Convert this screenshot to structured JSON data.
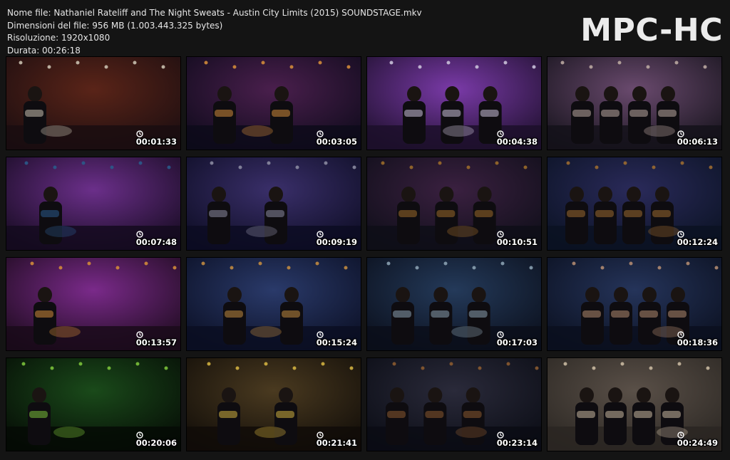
{
  "file_info": {
    "name_line": "Nome file: Nathaniel Rateliff and The Night Sweats - Austin City Limits (2015) SOUNDSTAGE.mkv",
    "size_line": "Dimensioni del file: 956 MB (1.003.443.325 bytes)",
    "resolution_line": "Risoluzione: 1920x1080",
    "duration_line": "Durata: 00:26:18"
  },
  "logo": "MPC-HC",
  "thumbnails": [
    {
      "time": "00:01:33",
      "scene": "drummer",
      "palette": [
        "#1a0d10",
        "#5a2418",
        "#c8bfae"
      ]
    },
    {
      "time": "00:03:05",
      "scene": "guitar-band",
      "palette": [
        "#0d0a1a",
        "#4a1f4d",
        "#d08a3a"
      ]
    },
    {
      "time": "00:04:38",
      "scene": "organ-purple",
      "palette": [
        "#1c0f2a",
        "#7a3aa8",
        "#c9c0d8"
      ]
    },
    {
      "time": "00:06:13",
      "scene": "drums-cymbals",
      "palette": [
        "#14121a",
        "#6a4a6e",
        "#b9a7a0"
      ]
    },
    {
      "time": "00:07:48",
      "scene": "wide-stage",
      "palette": [
        "#140a1e",
        "#6b2f8a",
        "#2a5a8a"
      ]
    },
    {
      "time": "00:09:19",
      "scene": "horns",
      "palette": [
        "#0c0c22",
        "#3a2f6a",
        "#8a8aa0"
      ]
    },
    {
      "time": "00:10:51",
      "scene": "keys-stage",
      "palette": [
        "#0e0e18",
        "#3a2040",
        "#9a6a2a"
      ]
    },
    {
      "time": "00:12:24",
      "scene": "band-stage",
      "palette": [
        "#0a1222",
        "#2a2a5a",
        "#9a6a30"
      ]
    },
    {
      "time": "00:13:57",
      "scene": "guitar-closeup",
      "palette": [
        "#1a0a1a",
        "#7a2a8a",
        "#d08a3a"
      ]
    },
    {
      "time": "00:15:24",
      "scene": "singer-skyline",
      "palette": [
        "#0a0e22",
        "#2a3a6a",
        "#c08a40"
      ]
    },
    {
      "time": "00:17:03",
      "scene": "drums-blue",
      "palette": [
        "#0a0e1a",
        "#243a5a",
        "#8aa0b0"
      ]
    },
    {
      "time": "00:18:36",
      "scene": "singer-mic",
      "palette": [
        "#0a0f1e",
        "#25345a",
        "#b08a70"
      ]
    },
    {
      "time": "00:20:06",
      "scene": "green-lights",
      "palette": [
        "#050a05",
        "#1a4a1a",
        "#7ac03a"
      ]
    },
    {
      "time": "00:21:41",
      "scene": "drums-sax",
      "palette": [
        "#100c08",
        "#4a3a20",
        "#d0b040"
      ]
    },
    {
      "time": "00:23:14",
      "scene": "keys-skyline",
      "palette": [
        "#0a0c14",
        "#2a2a3a",
        "#8a5a30"
      ]
    },
    {
      "time": "00:24:49",
      "scene": "interview",
      "palette": [
        "#2a2622",
        "#5a5048",
        "#c8b8a0"
      ]
    }
  ]
}
